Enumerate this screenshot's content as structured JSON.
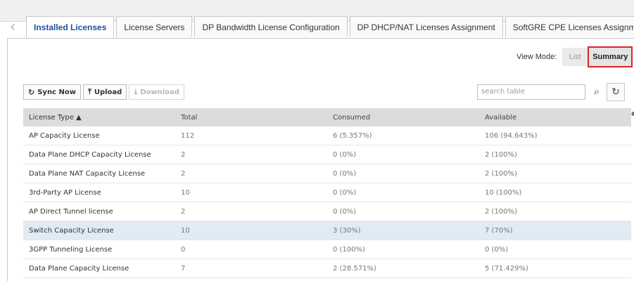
{
  "tabs": [
    {
      "label": "Installed Licenses",
      "active": true
    },
    {
      "label": "License Servers",
      "active": false
    },
    {
      "label": "DP Bandwidth License Configuration",
      "active": false
    },
    {
      "label": "DP DHCP/NAT Licenses Assignment",
      "active": false
    },
    {
      "label": "SoftGRE CPE Licenses Assignment",
      "active": false
    }
  ],
  "view_mode": {
    "label": "View Mode:",
    "options": [
      "List",
      "Summary"
    ],
    "selected": "Summary"
  },
  "toolbar": {
    "sync_now": "Sync Now",
    "upload": "Upload",
    "download": "Download"
  },
  "search": {
    "placeholder": "search table"
  },
  "table": {
    "columns": [
      "License Type ▲",
      "Total",
      "Consumed",
      "Available"
    ],
    "rows": [
      {
        "type": "AP Capacity License",
        "total": "112",
        "consumed": "6 (5.357%)",
        "available": "106 (94.643%)"
      },
      {
        "type": "Data Plane DHCP Capacity License",
        "total": "2",
        "consumed": "0 (0%)",
        "available": "2 (100%)"
      },
      {
        "type": "Data Plane NAT Capacity License",
        "total": "2",
        "consumed": "0 (0%)",
        "available": "2 (100%)"
      },
      {
        "type": "3rd-Party AP License",
        "total": "10",
        "consumed": "0 (0%)",
        "available": "10 (100%)"
      },
      {
        "type": "AP Direct Tunnel license",
        "total": "2",
        "consumed": "0 (0%)",
        "available": "2 (100%)"
      },
      {
        "type": "Switch Capacity License",
        "total": "10",
        "consumed": "3 (30%)",
        "available": "7 (70%)"
      },
      {
        "type": "3GPP Tunneling License",
        "total": "0",
        "consumed": "0 (100%)",
        "available": "0 (0%)"
      },
      {
        "type": "Data Plane Capacity License",
        "total": "7",
        "consumed": "2 (28.571%)",
        "available": "5 (71.429%)"
      }
    ]
  }
}
